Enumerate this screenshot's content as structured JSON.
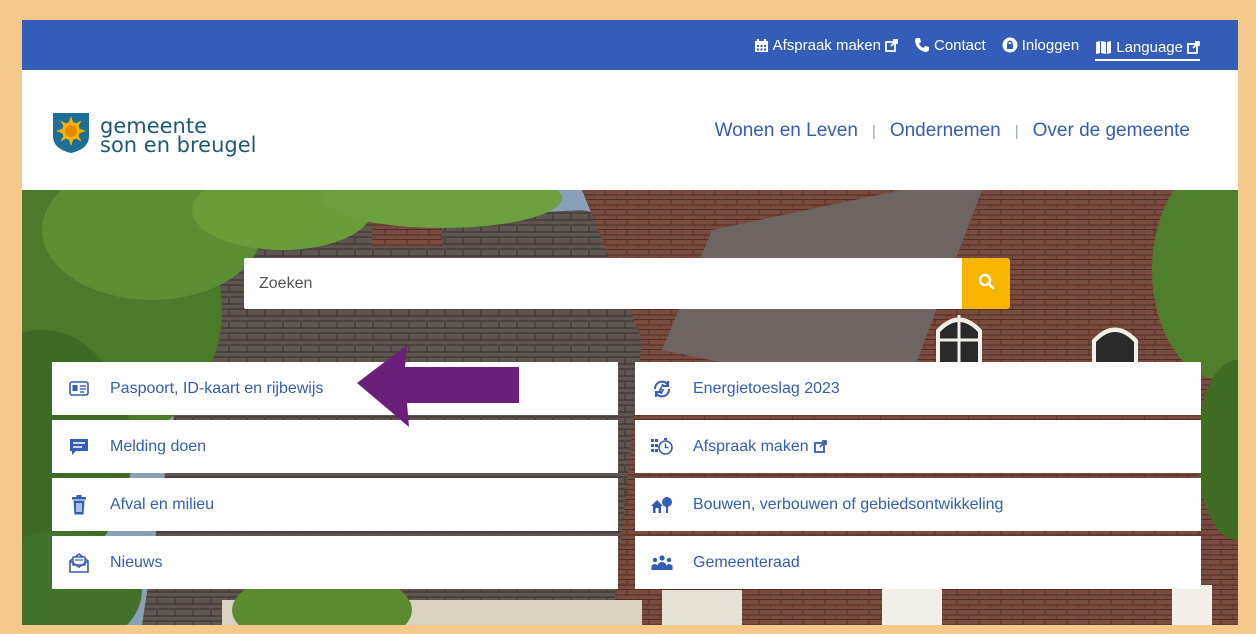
{
  "topbar": {
    "links": [
      {
        "label": "Afspraak maken",
        "icon": "calendar-icon",
        "external": true
      },
      {
        "label": "Contact",
        "icon": "phone-icon",
        "external": false
      },
      {
        "label": "Inloggen",
        "icon": "lock-icon",
        "external": false
      },
      {
        "label": "Language",
        "icon": "map-icon",
        "external": true
      }
    ]
  },
  "logo": {
    "line1": "gemeente",
    "line2": "son en breugel"
  },
  "mainnav": [
    "Wonen en Leven",
    "Ondernemen",
    "Over de gemeente"
  ],
  "search": {
    "placeholder": "Zoeken",
    "icon": "search-icon"
  },
  "tiles": {
    "left": [
      {
        "label": "Paspoort, ID-kaart en rijbewijs",
        "icon": "id-card-icon"
      },
      {
        "label": "Melding doen",
        "icon": "chat-icon"
      },
      {
        "label": "Afval en milieu",
        "icon": "trash-icon"
      },
      {
        "label": "Nieuws",
        "icon": "newsletter-icon"
      }
    ],
    "right": [
      {
        "label": "Energietoeslag 2023",
        "icon": "energy-refresh-icon"
      },
      {
        "label": "Afspraak maken",
        "icon": "appointment-clock-icon",
        "external": true
      },
      {
        "label": "Bouwen, verbouwen of gebiedsontwikkeling",
        "icon": "houses-icon"
      },
      {
        "label": "Gemeenteraad",
        "icon": "people-icon"
      }
    ]
  },
  "colors": {
    "primary": "#335db8",
    "accent": "#f7b500",
    "frame": "#f5c98c",
    "annotation_arrow": "#6a1f7a"
  }
}
